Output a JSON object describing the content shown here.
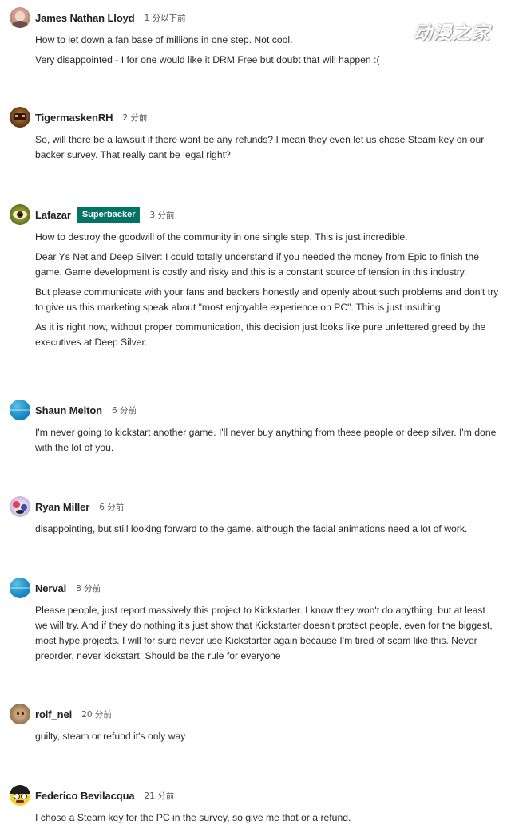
{
  "watermark": "动漫之家",
  "comments": [
    {
      "name": "James Nathan Lloyd",
      "time": "1 分以下前",
      "paragraphs": [
        "How to let down a fan base of millions in one step. Not cool.",
        "Very disappointed - I for one would like it DRM Free but doubt that will happen :("
      ]
    },
    {
      "name": "TigermaskenRH",
      "time": "2 分前",
      "paragraphs": [
        "So, will there be a lawsuit if there wont be any refunds? I mean they even let us chose Steam key on our backer survey. That really cant be legal right?"
      ]
    },
    {
      "name": "Lafazar",
      "badge": "Superbacker",
      "time": "3 分前",
      "paragraphs": [
        "How to destroy the goodwill of the community in one single step. This is just incredible.",
        "Dear Ys Net and Deep Silver: I could totally understand if you needed the money from Epic to finish the game. Game development is costly and risky and this is a constant source of tension in this industry.",
        "But please communicate with your fans and backers honestly and openly about such problems and don't try to give us this marketing speak about \"most enjoyable experience on PC\". This is just insulting.",
        "As it is right now, without proper communication, this decision just looks like pure unfettered greed by the executives at Deep Silver."
      ]
    },
    {
      "name": "Shaun Melton",
      "time": "6 分前",
      "paragraphs": [
        "I'm never going to kickstart another game. I'll never buy anything from these people or deep silver. I'm done with the lot of you."
      ]
    },
    {
      "name": "Ryan Miller",
      "time": "6 分前",
      "paragraphs": [
        "disappointing, but still looking forward to the game. although the facial animations need a lot of work."
      ]
    },
    {
      "name": "Nerval",
      "time": "8 分前",
      "paragraphs": [
        "Please people, just report massively this project to Kickstarter. I know they won't do anything, but at least we will try. And if they do nothing it's just show that Kickstarter doesn't protect people, even for the biggest, most hype projects. I will for sure never use Kickstarter again because I'm tired of scam like this. Never preorder, never kickstart. Should be the rule for everyone"
      ]
    },
    {
      "name": "rolf_nei",
      "time": "20 分前",
      "paragraphs": [
        "guilty, steam or refund it's only way"
      ]
    },
    {
      "name": "Federico Bevilacqua",
      "time": "21 分前",
      "paragraphs": [
        "I chose a Steam key for the PC in the survey, so give me that or a refund."
      ]
    }
  ]
}
